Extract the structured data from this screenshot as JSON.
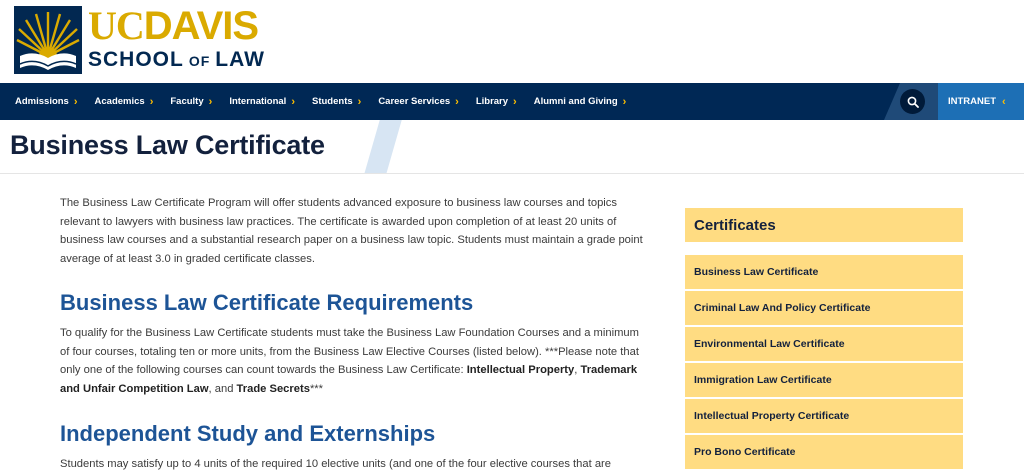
{
  "brand": {
    "top_uc": "UC",
    "top_davis": "DAVIS",
    "sub_school": "SCHOOL",
    "sub_of": "OF",
    "sub_law": "LAW"
  },
  "nav": {
    "items": [
      {
        "label": "Admissions"
      },
      {
        "label": "Academics"
      },
      {
        "label": "Faculty"
      },
      {
        "label": "International"
      },
      {
        "label": "Students"
      },
      {
        "label": "Career Services"
      },
      {
        "label": "Library"
      },
      {
        "label": "Alumni and Giving"
      }
    ],
    "intranet": "INTRANET",
    "chevron": "›",
    "intranet_chevron": "‹"
  },
  "page": {
    "title": "Business Law Certificate"
  },
  "content": {
    "intro": "The Business Law Certificate Program will offer students advanced exposure to business law courses and topics relevant to lawyers with business law practices. The certificate is awarded upon completion of at least 20 units of business law courses and a substantial research paper on a business law topic. Students must maintain a grade point average of at least 3.0 in graded certificate classes.",
    "h_requirements": "Business Law Certificate Requirements",
    "req_text_1": "To qualify for the Business Law Certificate students must take the Business Law Foundation Courses and a minimum of four courses, totaling ten or more units, from the Business Law Elective Courses (listed below). ***Please note that only one of the following courses can count towards the Business Law Certificate: ",
    "req_bold_1": "Intellectual Property",
    "req_sep_1": ", ",
    "req_bold_2": "Trademark and Unfair Competition Law",
    "req_sep_2": ", and ",
    "req_bold_3": "Trade Secrets",
    "req_end": "***",
    "h_independent": "Independent Study and Externships",
    "indep_text": "Students may satisfy up to 4 units of the required 10 elective units (and one of the four elective courses that are"
  },
  "sidebar": {
    "heading": "Certificates",
    "items": [
      {
        "label": "Business Law Certificate"
      },
      {
        "label": "Criminal Law And Policy Certificate"
      },
      {
        "label": "Environmental Law Certificate"
      },
      {
        "label": "Immigration Law Certificate"
      },
      {
        "label": "Intellectual Property Certificate"
      },
      {
        "label": "Pro Bono Certificate"
      }
    ]
  },
  "colors": {
    "navy": "#002855",
    "gold": "#DAAA00",
    "sidebar_bg": "#FFDC82",
    "heading_blue": "#1d5496",
    "intranet_blue": "#1d6fb5"
  },
  "icons": {
    "search": "search-icon",
    "seal": "ucdavis-sunburst-seal"
  }
}
